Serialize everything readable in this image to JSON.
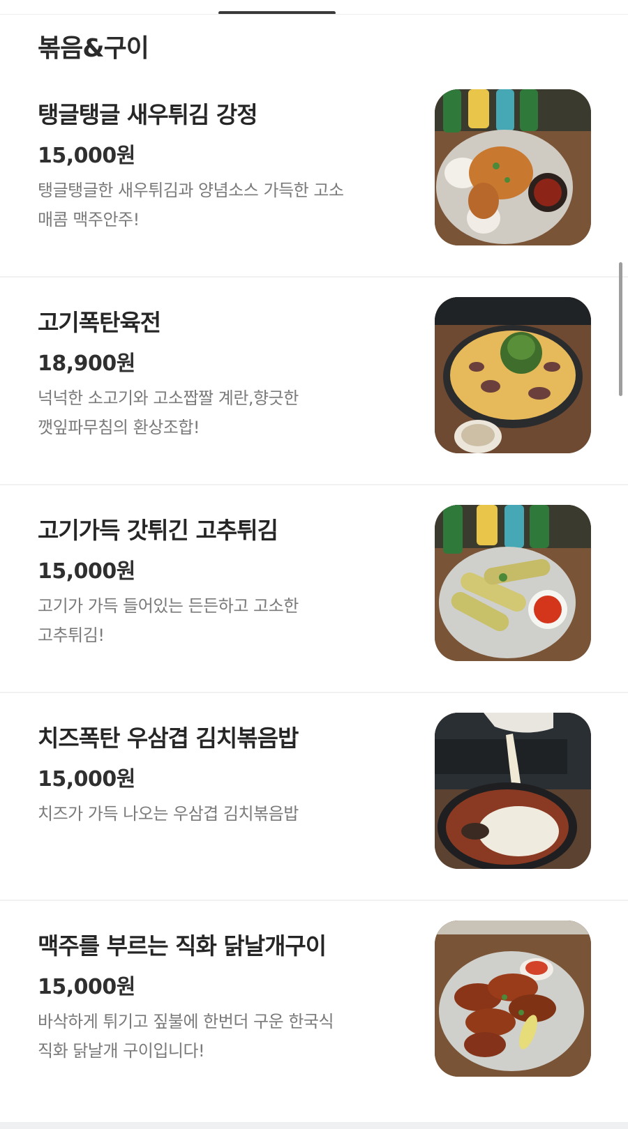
{
  "section": {
    "title": "볶음&구이"
  },
  "items": [
    {
      "name": "탱글탱글 새우튀김 강정",
      "price": "15,000원",
      "description": " 탱글탱글한 새우튀김과 양념소스 가득한 고소\n매콤 맥주안주!",
      "photo_icon": "fried-shrimp-photo"
    },
    {
      "name": "고기폭탄육전",
      "price": "18,900원",
      "description": "넉넉한 소고기와 고소짭짤 계란,향긋한\n깻잎파무침의 환상조합!",
      "photo_icon": "beef-jeon-photo"
    },
    {
      "name": "고기가득 갓튀긴 고추튀김",
      "price": "15,000원",
      "description": "고기가 가득 들어있는 든든하고 고소한\n고추튀김!",
      "photo_icon": "fried-pepper-photo"
    },
    {
      "name": "치즈폭탄 우삼겹 김치볶음밥",
      "price": "15,000원",
      "description": "치즈가 가득 나오는 우삼겹 김치볶음밥",
      "photo_icon": "kimchi-fried-rice-photo"
    },
    {
      "name": "맥주를 부르는 직화 닭날개구이",
      "price": "15,000원",
      "description": "바삭하게 튀기고 짚불에 한번더 구운 한국식\n직화 닭날개 구이입니다!",
      "photo_icon": "grilled-wings-photo"
    }
  ]
}
